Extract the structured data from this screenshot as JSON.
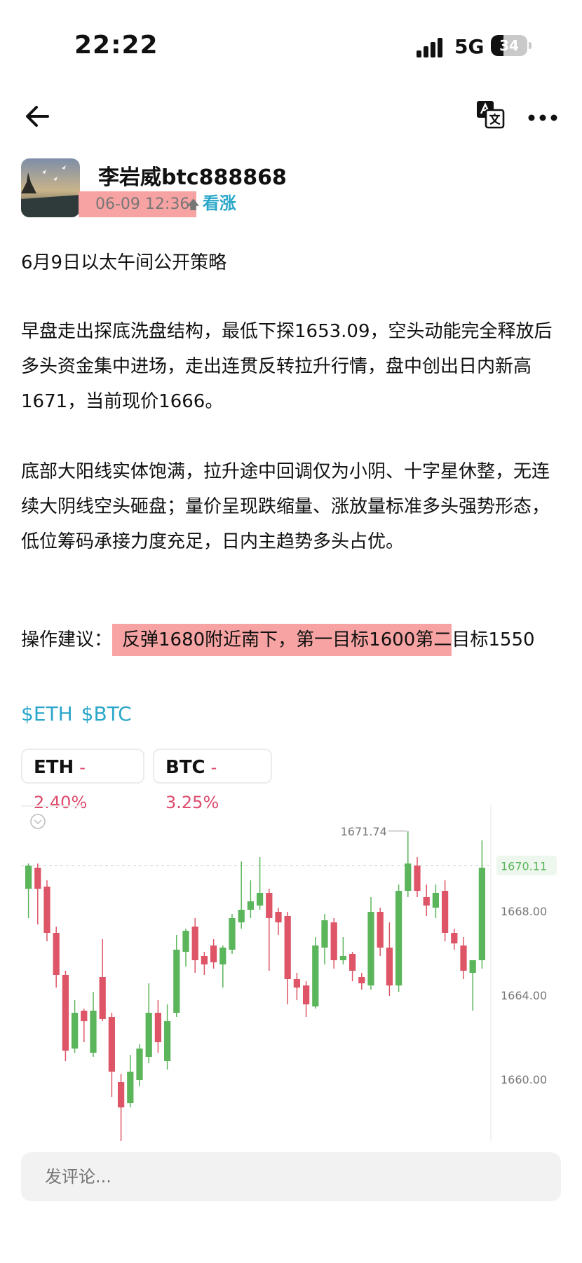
{
  "status_bar": {
    "time": "22:22",
    "network": "5G",
    "battery": "34",
    "battery_level": 0.34
  },
  "nav": {
    "back_icon": "arrow-left-icon",
    "translate_icon": "translate-icon",
    "more_icon": "more-dots-icon"
  },
  "author": {
    "name": "李岩威btc888868",
    "timestamp": "06-09 12:36",
    "sentiment": "看涨",
    "sentiment_color": "#2ba7c9",
    "highlight_color": "#f7a3a3"
  },
  "post": {
    "title": "6月9日以太午间公开策略",
    "para1": "早盘走出探底洗盘结构，最低下探1653.09，空头动能完全释放后多头资金集中进场，走出连贯反转拉升行情，盘中创出日内新高1671，当前现价1666。",
    "para2": "底部大阳线实体饱满，拉升途中回调仅为小阴、十字星休整，无连续大阴线空头砸盘；量价呈现跌缩量、涨放量标准多头强势形态，低位筹码承接力度充足，日内主趋势多头占优。",
    "advice_label": "操作建议：",
    "advice_highlight": "反弹1680附近南下，第一目标1600第二",
    "advice_rest": "目标1550"
  },
  "tags": [
    "$ETH",
    "$BTC"
  ],
  "tickers": [
    {
      "symbol": "ETH",
      "change": "-2.40%"
    },
    {
      "symbol": "BTC",
      "change": "-3.25%"
    }
  ],
  "chart_data": {
    "type": "candlestick",
    "y_ticks": [
      "1668.00",
      "1664.00",
      "1660.00"
    ],
    "y_tick_values": [
      1668,
      1664,
      1660
    ],
    "current_price_label": "1670.11",
    "current_price": 1670.11,
    "high_label": "1671.74",
    "high_value": 1671.74,
    "up_color": "#5bb55b",
    "down_color": "#dd5566",
    "candles": [
      {
        "o": 1669.0,
        "h": 1670.2,
        "l": 1667.6,
        "c": 1670.1
      },
      {
        "o": 1670.0,
        "h": 1670.2,
        "l": 1667.3,
        "c": 1669.0
      },
      {
        "o": 1669.1,
        "h": 1669.4,
        "l": 1666.5,
        "c": 1666.9
      },
      {
        "o": 1666.9,
        "h": 1667.2,
        "l": 1664.3,
        "c": 1664.9
      },
      {
        "o": 1664.9,
        "h": 1665.1,
        "l": 1660.8,
        "c": 1661.3
      },
      {
        "o": 1661.4,
        "h": 1663.7,
        "l": 1661.2,
        "c": 1663.1
      },
      {
        "o": 1663.2,
        "h": 1663.3,
        "l": 1661.7,
        "c": 1662.7
      },
      {
        "o": 1661.2,
        "h": 1664.1,
        "l": 1661.0,
        "c": 1663.2
      },
      {
        "o": 1664.8,
        "h": 1666.6,
        "l": 1662.7,
        "c": 1662.8
      },
      {
        "o": 1662.9,
        "h": 1663.1,
        "l": 1659.1,
        "c": 1660.3
      },
      {
        "o": 1659.8,
        "h": 1660.2,
        "l": 1657.0,
        "c": 1658.6
      },
      {
        "o": 1658.8,
        "h": 1661.1,
        "l": 1658.6,
        "c": 1660.3
      },
      {
        "o": 1659.9,
        "h": 1661.6,
        "l": 1659.6,
        "c": 1661.4
      },
      {
        "o": 1661.0,
        "h": 1664.5,
        "l": 1660.7,
        "c": 1663.1
      },
      {
        "o": 1663.1,
        "h": 1663.7,
        "l": 1661.2,
        "c": 1661.7
      },
      {
        "o": 1660.8,
        "h": 1663.5,
        "l": 1660.4,
        "c": 1662.7
      },
      {
        "o": 1663.1,
        "h": 1666.8,
        "l": 1662.9,
        "c": 1666.1
      },
      {
        "o": 1666.0,
        "h": 1667.1,
        "l": 1665.3,
        "c": 1667.0
      },
      {
        "o": 1667.2,
        "h": 1667.6,
        "l": 1665.0,
        "c": 1665.6
      },
      {
        "o": 1665.8,
        "h": 1666.0,
        "l": 1664.9,
        "c": 1665.4
      },
      {
        "o": 1666.3,
        "h": 1666.6,
        "l": 1665.2,
        "c": 1665.5
      },
      {
        "o": 1665.4,
        "h": 1666.3,
        "l": 1664.3,
        "c": 1666.2
      },
      {
        "o": 1666.1,
        "h": 1667.8,
        "l": 1665.9,
        "c": 1667.6
      },
      {
        "o": 1667.4,
        "h": 1670.3,
        "l": 1667.1,
        "c": 1668.0
      },
      {
        "o": 1668.0,
        "h": 1669.4,
        "l": 1667.6,
        "c": 1668.4
      },
      {
        "o": 1668.2,
        "h": 1670.5,
        "l": 1668.0,
        "c": 1668.8
      },
      {
        "o": 1668.8,
        "h": 1669.0,
        "l": 1665.1,
        "c": 1667.6
      },
      {
        "o": 1667.9,
        "h": 1668.1,
        "l": 1666.8,
        "c": 1667.4
      },
      {
        "o": 1667.7,
        "h": 1667.9,
        "l": 1663.5,
        "c": 1664.7
      },
      {
        "o": 1664.7,
        "h": 1665.0,
        "l": 1663.7,
        "c": 1664.3
      },
      {
        "o": 1664.4,
        "h": 1664.6,
        "l": 1662.9,
        "c": 1663.5
      },
      {
        "o": 1663.4,
        "h": 1666.7,
        "l": 1663.3,
        "c": 1666.3
      },
      {
        "o": 1666.2,
        "h": 1667.8,
        "l": 1665.4,
        "c": 1667.5
      },
      {
        "o": 1667.4,
        "h": 1667.6,
        "l": 1665.2,
        "c": 1665.6
      },
      {
        "o": 1665.6,
        "h": 1666.7,
        "l": 1665.4,
        "c": 1665.8
      },
      {
        "o": 1665.9,
        "h": 1666.0,
        "l": 1664.6,
        "c": 1665.1
      },
      {
        "o": 1664.8,
        "h": 1665.0,
        "l": 1664.2,
        "c": 1664.5
      },
      {
        "o": 1664.4,
        "h": 1668.6,
        "l": 1664.2,
        "c": 1667.9
      },
      {
        "o": 1667.9,
        "h": 1668.1,
        "l": 1665.8,
        "c": 1666.2
      },
      {
        "o": 1666.2,
        "h": 1667.4,
        "l": 1663.9,
        "c": 1664.4
      },
      {
        "o": 1664.4,
        "h": 1669.2,
        "l": 1664.1,
        "c": 1668.9
      },
      {
        "o": 1668.9,
        "h": 1671.74,
        "l": 1668.6,
        "c": 1670.2
      },
      {
        "o": 1670.1,
        "h": 1670.5,
        "l": 1668.6,
        "c": 1668.9
      },
      {
        "o": 1668.6,
        "h": 1669.2,
        "l": 1667.7,
        "c": 1668.2
      },
      {
        "o": 1668.1,
        "h": 1669.2,
        "l": 1667.6,
        "c": 1668.8
      },
      {
        "o": 1668.9,
        "h": 1669.4,
        "l": 1666.5,
        "c": 1666.9
      },
      {
        "o": 1666.9,
        "h": 1667.1,
        "l": 1666.1,
        "c": 1666.4
      },
      {
        "o": 1666.3,
        "h": 1666.7,
        "l": 1664.7,
        "c": 1665.1
      },
      {
        "o": 1665.0,
        "h": 1665.2,
        "l": 1663.2,
        "c": 1665.6
      },
      {
        "o": 1665.6,
        "h": 1671.3,
        "l": 1665.2,
        "c": 1670.0
      }
    ]
  },
  "comment": {
    "placeholder": "发评论..."
  }
}
